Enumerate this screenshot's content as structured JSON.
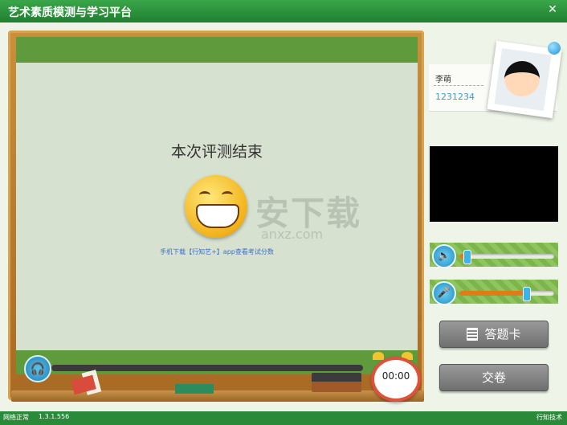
{
  "window": {
    "title": "艺术素质模测与学习平台",
    "close_glyph": "✕"
  },
  "board": {
    "heading": "本次评测结束",
    "download_hint": "手机下载【行知艺+】app查看考试分数",
    "watermark": {
      "logo": "安下载",
      "domain": "anxz.com"
    }
  },
  "audio": {
    "progress": 0
  },
  "clock": {
    "time": "00:00"
  },
  "student": {
    "name": "李萌",
    "id": "1231234"
  },
  "controls": {
    "volume_level": 0.08,
    "mic_level": 0.7
  },
  "buttons": {
    "answer_card": "答题卡",
    "submit": "交卷"
  },
  "status": {
    "network": "网络正常",
    "version": "1.3.1.556",
    "brand": "行知技术"
  },
  "colors": {
    "accent_green": "#2f8d3d",
    "board_green": "#5f9a3d",
    "slider_fill": "#e07b1b"
  }
}
